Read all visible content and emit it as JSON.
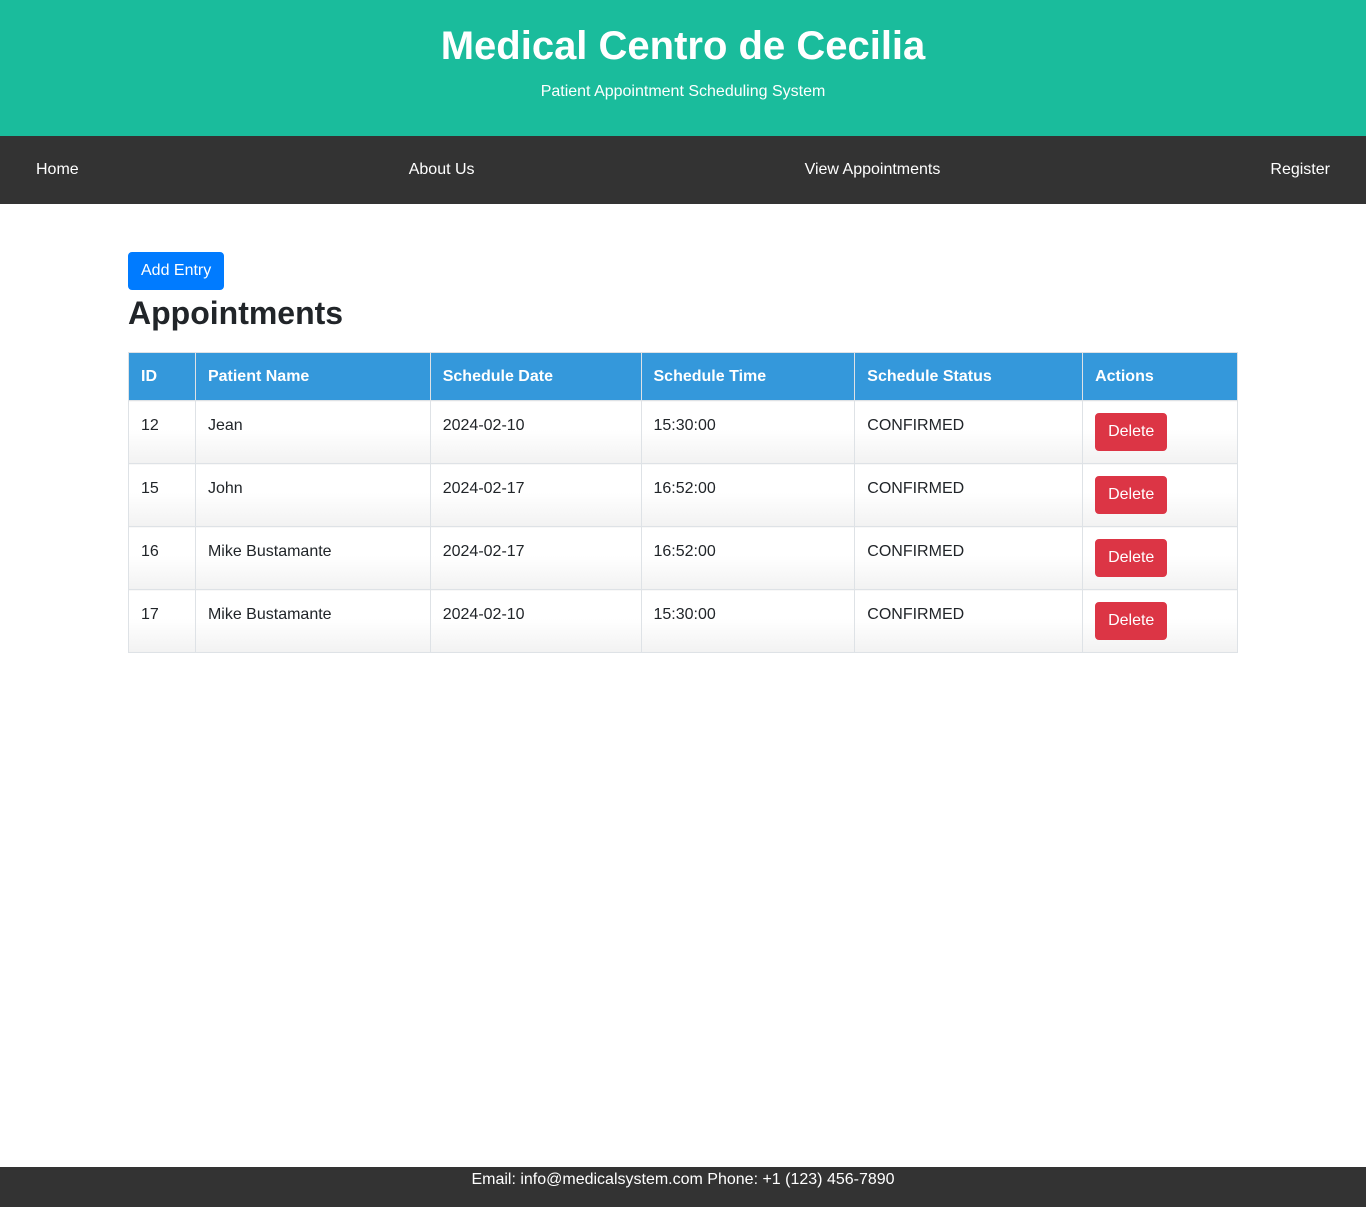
{
  "header": {
    "title": "Medical Centro de Cecilia",
    "subtitle": "Patient Appointment Scheduling System"
  },
  "nav": {
    "items": [
      {
        "label": "Home"
      },
      {
        "label": "About Us"
      },
      {
        "label": "View Appointments"
      },
      {
        "label": "Register"
      }
    ]
  },
  "main": {
    "add_button_label": "Add Entry",
    "title": "Appointments",
    "table": {
      "columns": [
        "ID",
        "Patient Name",
        "Schedule Date",
        "Schedule Time",
        "Schedule Status",
        "Actions"
      ],
      "action_label": "Delete",
      "rows": [
        {
          "id": "12",
          "patient_name": "Jean",
          "schedule_date": "2024-02-10",
          "schedule_time": "15:30:00",
          "schedule_status": "CONFIRMED"
        },
        {
          "id": "15",
          "patient_name": "John",
          "schedule_date": "2024-02-17",
          "schedule_time": "16:52:00",
          "schedule_status": "CONFIRMED"
        },
        {
          "id": "16",
          "patient_name": "Mike Bustamante",
          "schedule_date": "2024-02-17",
          "schedule_time": "16:52:00",
          "schedule_status": "CONFIRMED"
        },
        {
          "id": "17",
          "patient_name": "Mike Bustamante",
          "schedule_date": "2024-02-10",
          "schedule_time": "15:30:00",
          "schedule_status": "CONFIRMED"
        }
      ]
    }
  },
  "footer": {
    "text": "Email: info@medicalsystem.com Phone: +1 (123) 456-7890"
  },
  "colors": {
    "header_bg": "#1abc9c",
    "nav_bg": "#333333",
    "table_header_bg": "#3498db",
    "primary_button": "#007bff",
    "danger_button": "#dc3545"
  }
}
